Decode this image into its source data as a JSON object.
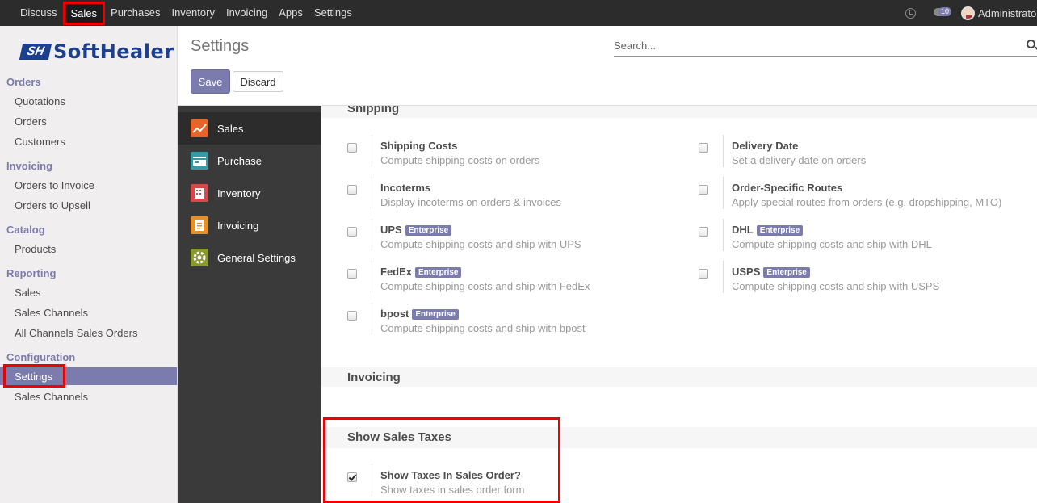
{
  "topbar": {
    "menu": [
      "Discuss",
      "Sales",
      "Purchases",
      "Inventory",
      "Invoicing",
      "Apps",
      "Settings"
    ],
    "messages_count": "10",
    "username": "Administrator"
  },
  "sidebar": {
    "logo_mark": "SH",
    "logo_text": "SoftHealer",
    "sections": {
      "orders": "Orders",
      "invoicing": "Invoicing",
      "catalog": "Catalog",
      "reporting": "Reporting",
      "configuration": "Configuration"
    },
    "items": {
      "quotations": "Quotations",
      "orders": "Orders",
      "customers": "Customers",
      "orders_to_invoice": "Orders to Invoice",
      "orders_to_upsell": "Orders to Upsell",
      "products": "Products",
      "sales": "Sales",
      "sales_channels": "Sales Channels",
      "all_channels_sales_orders": "All Channels Sales Orders",
      "settings": "Settings",
      "config_sales_channels": "Sales Channels"
    }
  },
  "control_panel": {
    "title": "Settings",
    "search_placeholder": "Search...",
    "save": "Save",
    "discard": "Discard"
  },
  "apps": [
    "Sales",
    "Purchase",
    "Inventory",
    "Invoicing",
    "General Settings"
  ],
  "main": {
    "shipping_title": "Shipping",
    "enterprise_badge": "Enterprise",
    "options": {
      "shipping_costs": {
        "label": "Shipping Costs",
        "desc": "Compute shipping costs on orders"
      },
      "delivery_date": {
        "label": "Delivery Date",
        "desc": "Set a delivery date on orders"
      },
      "incoterms": {
        "label": "Incoterms",
        "desc": "Display incoterms on orders & invoices"
      },
      "order_routes": {
        "label": "Order-Specific Routes",
        "desc": "Apply special routes from orders (e.g. dropshipping, MTO)"
      },
      "ups": {
        "label": "UPS",
        "desc": "Compute shipping costs and ship with UPS"
      },
      "dhl": {
        "label": "DHL",
        "desc": "Compute shipping costs and ship with DHL"
      },
      "fedex": {
        "label": "FedEx",
        "desc": "Compute shipping costs and ship with FedEx"
      },
      "usps": {
        "label": "USPS",
        "desc": "Compute shipping costs and ship with USPS"
      },
      "bpost": {
        "label": "bpost",
        "desc": "Compute shipping costs and ship with bpost"
      },
      "show_taxes": {
        "label": "Show Taxes In Sales Order?",
        "desc": "Show taxes in sales order form",
        "checked": true
      }
    },
    "invoicing_title": "Invoicing",
    "taxes_title": "Show Sales Taxes"
  }
}
